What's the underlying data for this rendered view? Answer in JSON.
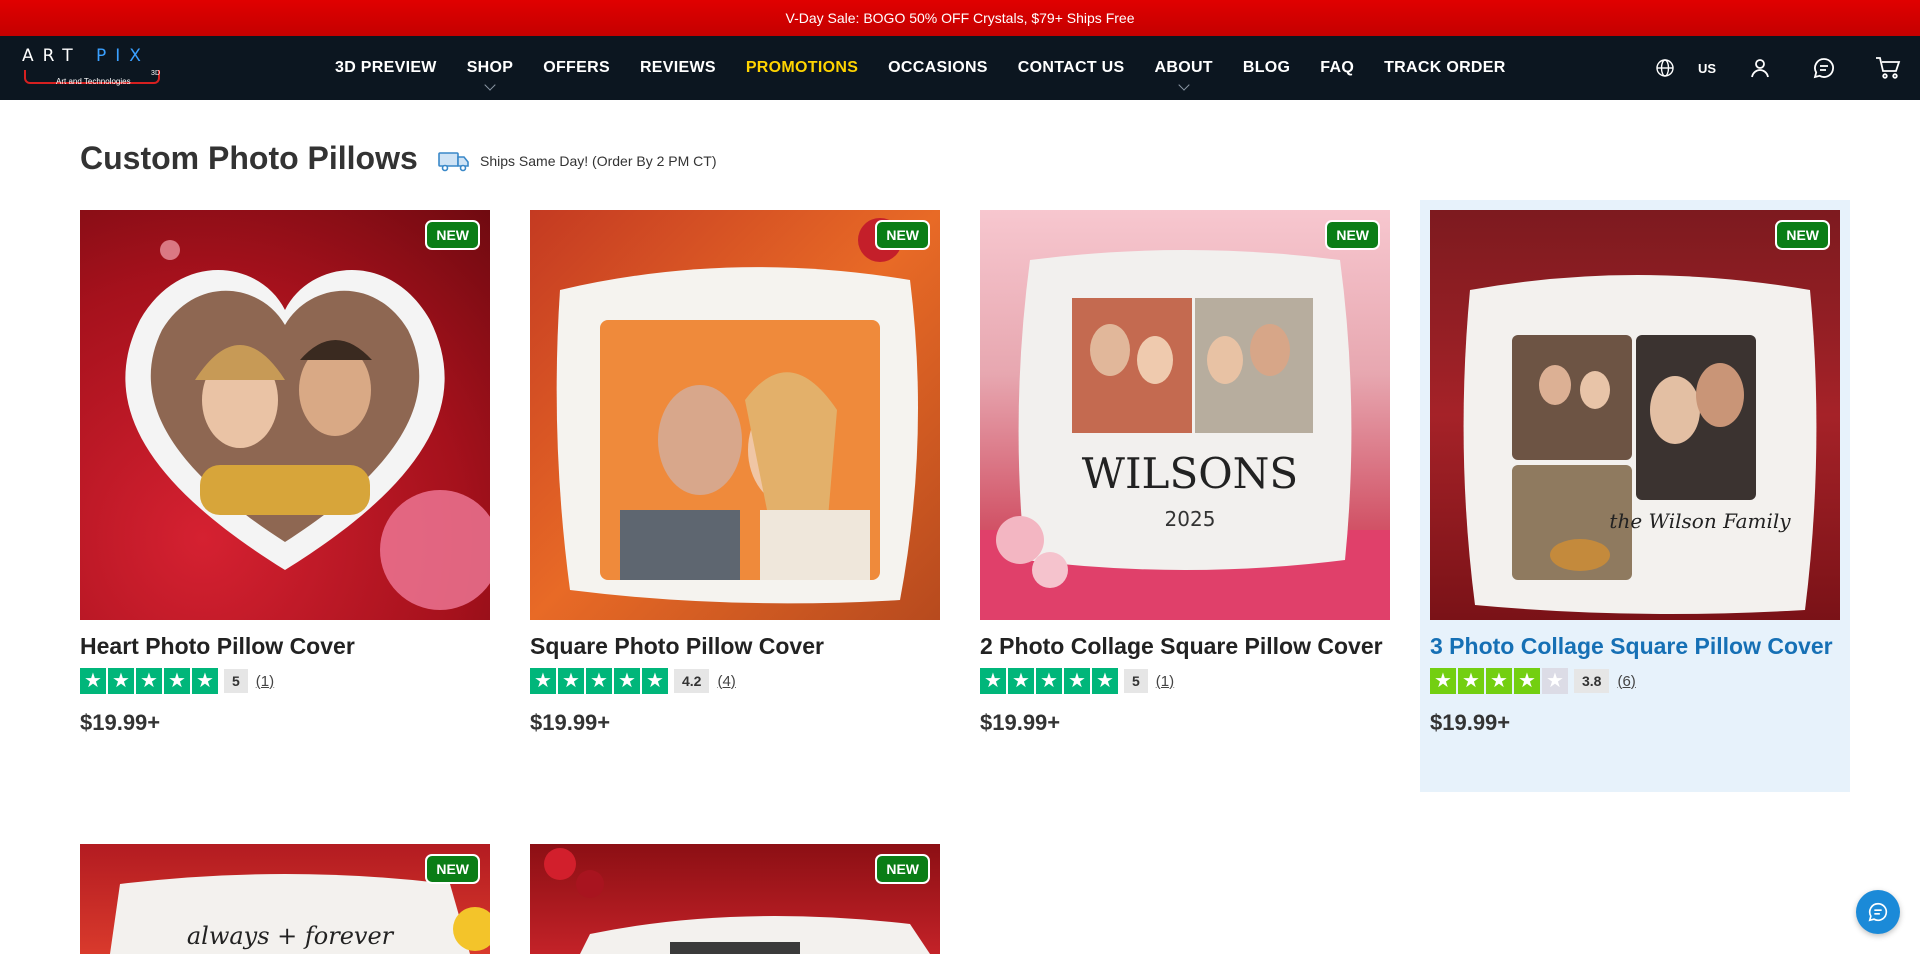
{
  "promo": {
    "text": "V-Day Sale: BOGO 50% OFF Crystals, $79+ Ships Free"
  },
  "logo": {
    "word_a": "ART",
    "word_b": "PIX",
    "tag": "Art and Technologies",
    "suffix": "3D"
  },
  "nav": {
    "items": [
      {
        "label": "3D PREVIEW"
      },
      {
        "label": "SHOP"
      },
      {
        "label": "OFFERS"
      },
      {
        "label": "REVIEWS"
      },
      {
        "label": "PROMOTIONS"
      },
      {
        "label": "OCCASIONS"
      },
      {
        "label": "CONTACT US"
      },
      {
        "label": "ABOUT"
      },
      {
        "label": "BLOG"
      },
      {
        "label": "FAQ"
      },
      {
        "label": "TRACK ORDER"
      }
    ],
    "region": "US"
  },
  "page": {
    "title": "Custom Photo Pillows",
    "ships": "Ships Same Day! (Order By 2 PM CT)"
  },
  "products": [
    {
      "badge": "NEW",
      "title": "Heart Photo Pillow Cover",
      "score": "5",
      "count": "(1)",
      "price": "$19.99+",
      "stars": 5
    },
    {
      "badge": "NEW",
      "title": "Square Photo Pillow Cover",
      "score": "4.2",
      "count": "(4)",
      "price": "$19.99+",
      "stars": 5
    },
    {
      "badge": "NEW",
      "title": "2 Photo Collage Square Pillow Cover",
      "score": "5",
      "count": "(1)",
      "price": "$19.99+",
      "stars": 5,
      "print_name": "WILSONS",
      "print_year": "2025"
    },
    {
      "badge": "NEW",
      "title": "3 Photo Collage Square Pillow Cover",
      "score": "3.8",
      "count": "(6)",
      "price": "$19.99+",
      "stars": 4,
      "print_text": "the Wilson Family"
    },
    {
      "badge": "NEW",
      "print_text": "always + forever"
    },
    {
      "badge": "NEW"
    }
  ],
  "colors": {
    "promo_red": "#d80000",
    "nav_bg": "#0c1620",
    "promo_link": "#ffd400",
    "badge_green": "#0a7d16",
    "star_green": "#00b67a"
  }
}
